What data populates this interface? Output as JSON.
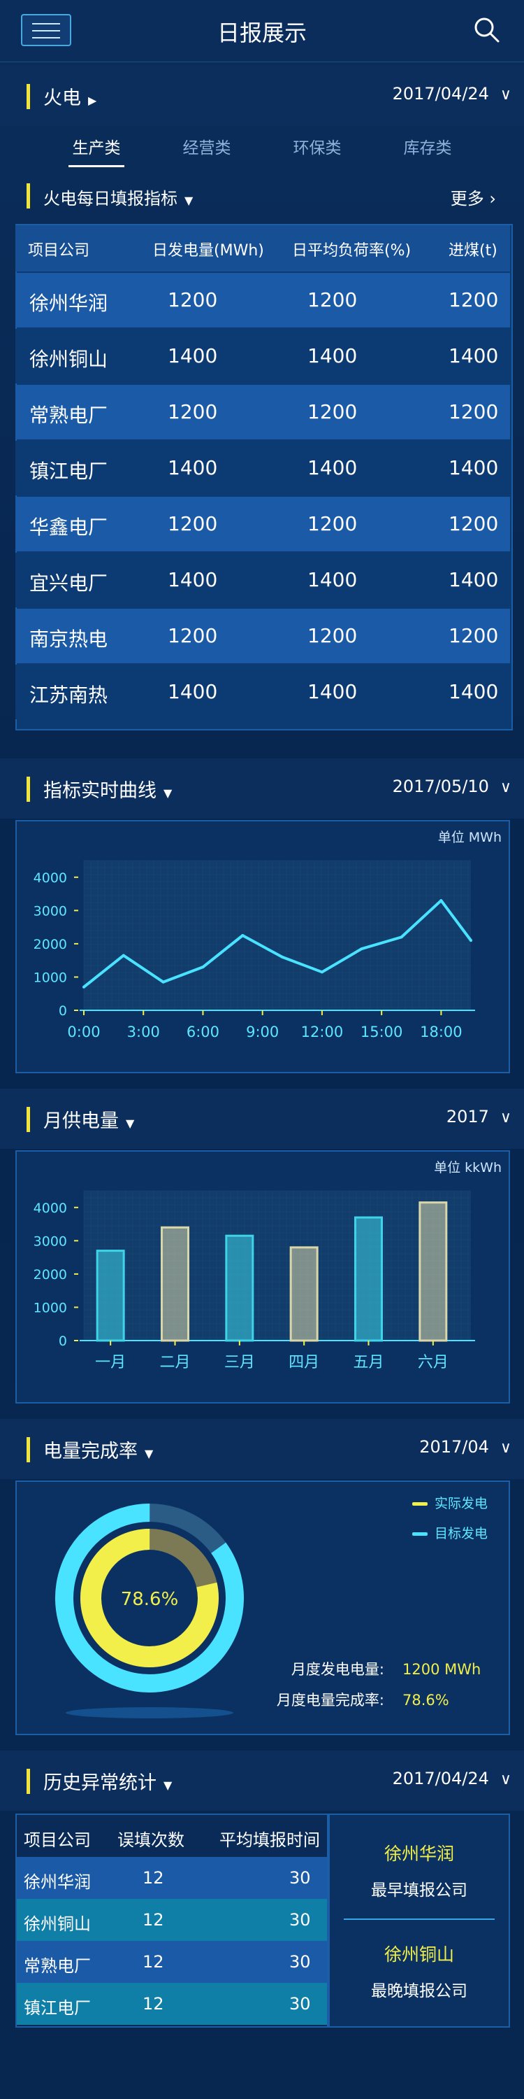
{
  "header": {
    "title": "日报展示",
    "menu_icon": "hamburger-icon",
    "search_icon": "search-icon"
  },
  "section_thermal": {
    "title": "火电",
    "date": "2017/04/24"
  },
  "tabs": [
    {
      "label": "生产类",
      "active": true
    },
    {
      "label": "经营类",
      "active": false
    },
    {
      "label": "环保类",
      "active": false
    },
    {
      "label": "库存类",
      "active": false
    }
  ],
  "daily_indicators": {
    "title": "火电每日填报指标",
    "more": "更多",
    "columns": [
      "项目公司",
      "日发电量(MWh)",
      "日平均负荷率(%)",
      "进煤(t)"
    ],
    "rows": [
      [
        "徐州华润",
        "1200",
        "1200",
        "1200"
      ],
      [
        "徐州铜山",
        "1400",
        "1400",
        "1400"
      ],
      [
        "常熟电厂",
        "1200",
        "1200",
        "1200"
      ],
      [
        "镇江电厂",
        "1400",
        "1400",
        "1400"
      ],
      [
        "华鑫电厂",
        "1200",
        "1200",
        "1200"
      ],
      [
        "宜兴电厂",
        "1400",
        "1400",
        "1400"
      ],
      [
        "南京热电",
        "1200",
        "1200",
        "1200"
      ],
      [
        "江苏南热",
        "1400",
        "1400",
        "1400"
      ]
    ]
  },
  "realtime_curve": {
    "title": "指标实时曲线",
    "date": "2017/05/10",
    "unit": "单位 MWh"
  },
  "monthly_supply": {
    "title": "月供电量",
    "date": "2017",
    "unit": "单位 kkWh"
  },
  "completion": {
    "title": "电量完成率",
    "date": "2017/04",
    "percent_label": "78.6%",
    "legend": [
      {
        "label": "实际发电",
        "color": "#f2ee4a"
      },
      {
        "label": "目标发电",
        "color": "#49e3ff"
      }
    ],
    "stats": [
      {
        "label": "月度发电电量:",
        "value": "1200 MWh"
      },
      {
        "label": "月度电量完成率:",
        "value": "78.6%"
      }
    ]
  },
  "history": {
    "title": "历史异常统计",
    "date": "2017/04/24",
    "columns": [
      "项目公司",
      "误填次数",
      "平均填报时间"
    ],
    "rows": [
      [
        "徐州华润",
        "12",
        "30"
      ],
      [
        "徐州铜山",
        "12",
        "30"
      ],
      [
        "常熟电厂",
        "12",
        "30"
      ],
      [
        "镇江电厂",
        "12",
        "30"
      ]
    ],
    "earliest": {
      "company": "徐州华润",
      "label": "最早填报公司"
    },
    "latest": {
      "company": "徐州铜山",
      "label": "最晚填报公司"
    }
  },
  "chart_data": [
    {
      "type": "line",
      "title": "指标实时曲线",
      "unit": "MWh",
      "x_ticks": [
        "0:00",
        "3:00",
        "6:00",
        "9:00",
        "12:00",
        "15:00",
        "18:00"
      ],
      "y_ticks": [
        "0",
        "1000",
        "2000",
        "3000",
        "4000"
      ],
      "ylim": [
        0,
        4500
      ],
      "xlim": [
        0,
        19.5
      ],
      "x": [
        0,
        2,
        4,
        6,
        8,
        10,
        12,
        14,
        16,
        18,
        19.5
      ],
      "y": [
        700,
        1650,
        850,
        1300,
        2250,
        1600,
        1150,
        1850,
        2200,
        3300,
        2100
      ]
    },
    {
      "type": "bar",
      "title": "月供电量",
      "unit": "kkWh",
      "categories": [
        "一月",
        "二月",
        "三月",
        "四月",
        "五月",
        "六月"
      ],
      "y_ticks": [
        "0",
        "1000",
        "2000",
        "3000",
        "4000"
      ],
      "ylim": [
        0,
        4500
      ],
      "values": [
        2700,
        3400,
        3150,
        2800,
        3700,
        4150
      ],
      "colors": [
        "#3ed3e8",
        "#d9d6a8",
        "#3ed3e8",
        "#d9d6a8",
        "#3ed3e8",
        "#d9d6a8"
      ]
    },
    {
      "type": "pie",
      "title": "电量完成率",
      "series": [
        {
          "name": "实际发电",
          "values": [
            78.6
          ]
        },
        {
          "name": "目标发电",
          "values": [
            100
          ]
        }
      ]
    }
  ]
}
